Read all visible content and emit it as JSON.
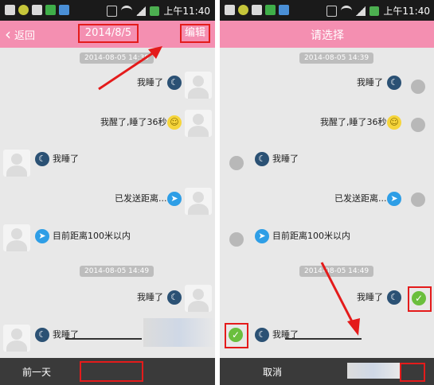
{
  "status_bar": {
    "time": "上午11:40"
  },
  "left": {
    "header": {
      "back_label": "返回",
      "date_title": "2014/8/5",
      "edit_label": "编辑"
    },
    "timestamps": [
      "2014-08-05 14:39",
      "2014-08-05 14:49"
    ],
    "messages": [
      {
        "text": "我睡了",
        "icon": "moon-icon",
        "side": "right"
      },
      {
        "text": "我醒了,睡了36秒",
        "icon": "smile-icon",
        "side": "right"
      },
      {
        "text": "我睡了",
        "icon": "moon-icon",
        "side": "left"
      },
      {
        "text": "已发送距离...",
        "icon": "location-icon",
        "side": "right"
      },
      {
        "text": "目前距离100米以内",
        "icon": "location-icon",
        "side": "left"
      },
      {
        "text": "我睡了",
        "icon": "moon-icon",
        "side": "right"
      },
      {
        "text": "我睡了",
        "icon": "moon-icon",
        "side": "left"
      }
    ],
    "bottom": {
      "prev_day_label": "前一天"
    }
  },
  "right": {
    "header": {
      "title": "请选择"
    },
    "timestamps": [
      "2014-08-05 14:39",
      "2014-08-05 14:49"
    ],
    "messages": [
      {
        "text": "我睡了",
        "icon": "moon-icon",
        "selected": false
      },
      {
        "text": "我醒了,睡了36秒",
        "icon": "smile-icon",
        "selected": false
      },
      {
        "text": "我睡了",
        "icon": "moon-icon",
        "selected": false
      },
      {
        "text": "已发送距离...",
        "icon": "location-icon",
        "selected": false
      },
      {
        "text": "目前距离100米以内",
        "icon": "location-icon",
        "selected": false
      },
      {
        "text": "我睡了",
        "icon": "moon-icon",
        "selected": true
      },
      {
        "text": "我睡了",
        "icon": "moon-icon",
        "selected": true
      }
    ],
    "bottom": {
      "cancel_label": "取消"
    }
  },
  "colors": {
    "header_pink": "#f48fb1",
    "annotation_red": "#e41b1b",
    "check_green": "#6abf3d",
    "moon_navy": "#2b5174",
    "location_blue": "#2e9ee6"
  }
}
